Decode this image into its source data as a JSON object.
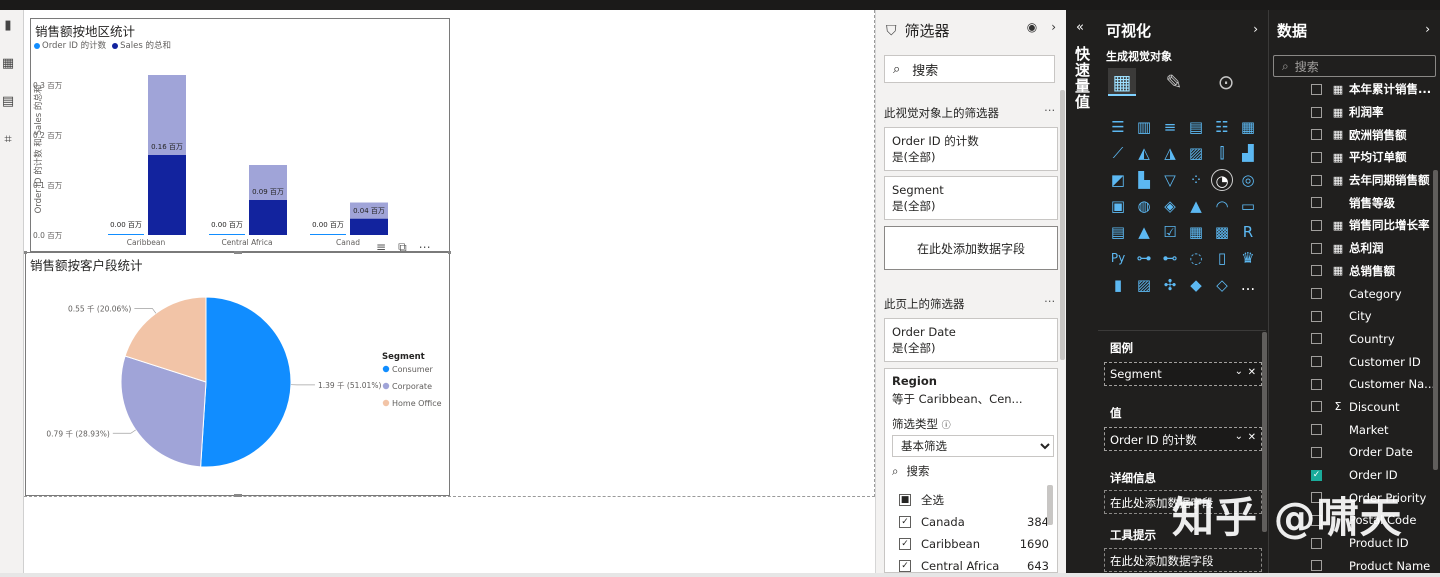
{
  "left_rail": {
    "icons": [
      "report-view-icon",
      "table-view-icon",
      "model-view-icon",
      "dax-query-icon"
    ]
  },
  "chart1": {
    "title": "销售额按地区统计",
    "legend": [
      "Order ID 的计数",
      "Sales 的总和"
    ],
    "ylabel": "Order ID 的计数 和 Sales 的总和"
  },
  "chart2": {
    "title": "销售额按客户段统计",
    "legend_title": "Segment"
  },
  "chart_data": [
    {
      "type": "bar",
      "title": "销售额按地区统计",
      "ylabel": "Order ID 的计数 和 Sales 的总和",
      "ylim": [
        0,
        0.3
      ],
      "y_ticks": [
        "0.0 百万",
        "0.1 百万",
        "0.2 百万",
        "0.3 百万"
      ],
      "categories": [
        "Caribbean",
        "Central Africa",
        "Canad"
      ],
      "series": [
        {
          "name": "Order ID 的计数",
          "values": [
            0.0,
            0.0,
            0.0
          ],
          "labels": [
            "0.00 百万",
            "0.00 百万",
            "0.00 百万"
          ],
          "color": "#118dff"
        },
        {
          "name": "Sales 的总和",
          "values": [
            0.32,
            0.14,
            0.065
          ],
          "color": "#12239e"
        }
      ],
      "overlay_labels": [
        "0.16 百万",
        "0.09 百万",
        "0.04 百万"
      ],
      "legend_position": "top-left"
    },
    {
      "type": "pie",
      "title": "销售额按客户段统计",
      "legend_title": "Segment",
      "legend_position": "right",
      "slices": [
        {
          "name": "Consumer",
          "value": 1390,
          "pct": 51.01,
          "label": "1.39 千 (51.01%)",
          "color": "#118dff"
        },
        {
          "name": "Corporate",
          "value": 790,
          "pct": 28.93,
          "label": "0.79 千 (28.93%)",
          "color": "#a0a4d8"
        },
        {
          "name": "Home Office",
          "value": 550,
          "pct": 20.06,
          "label": "0.55 千 (20.06%)",
          "color": "#f2c4a7"
        }
      ]
    }
  ],
  "filters": {
    "title": "筛选器",
    "search_placeholder": "搜索",
    "visual_section": "此视觉对象上的筛选器",
    "visual_cards": [
      {
        "name": "Order ID 的计数",
        "value": "是(全部)"
      },
      {
        "name": "Segment",
        "value": "是(全部)"
      }
    ],
    "add_field": "在此处添加数据字段",
    "page_section": "此页上的筛选器",
    "page_cards": [
      {
        "name": "Order Date",
        "value": "是(全部)"
      }
    ],
    "region": {
      "name": "Region",
      "summary": "等于 Caribbean、Cen...",
      "filter_type_label": "筛选类型",
      "filter_type_value": "基本筛选",
      "search": "搜索",
      "items": [
        {
          "label": "全选",
          "count": "",
          "state": "partial"
        },
        {
          "label": "Canada",
          "count": "384",
          "state": "checked"
        },
        {
          "label": "Caribbean",
          "count": "1690",
          "state": "checked"
        },
        {
          "label": "Central Africa",
          "count": "643",
          "state": "checked"
        }
      ]
    }
  },
  "bookmarks_rail": {
    "label": "快速量值"
  },
  "viz": {
    "title": "可视化",
    "build_label": "生成视觉对象",
    "legend_label": "图例",
    "legend_field": "Segment",
    "values_label": "值",
    "values_field": "Order ID 的计数",
    "details_label": "详细信息",
    "details_placeholder": "在此处添加数据字段",
    "tooltips_label": "工具提示",
    "tooltips_placeholder": "在此处添加数据字段",
    "more": "..."
  },
  "data_pane": {
    "title": "数据",
    "search_placeholder": "搜索",
    "fields": [
      {
        "label": "本年累计销售...",
        "icon": "calculator",
        "checked": false,
        "bold": true
      },
      {
        "label": "利润率",
        "icon": "calculator",
        "checked": false,
        "bold": true
      },
      {
        "label": "欧洲销售额",
        "icon": "calculator",
        "checked": false,
        "bold": true
      },
      {
        "label": "平均订单额",
        "icon": "calculator",
        "checked": false,
        "bold": true
      },
      {
        "label": "去年同期销售额",
        "icon": "calculator",
        "checked": false,
        "bold": true
      },
      {
        "label": "销售等级",
        "icon": "",
        "checked": false,
        "bold": true
      },
      {
        "label": "销售同比增长率",
        "icon": "calculator",
        "checked": false,
        "bold": true
      },
      {
        "label": "总利润",
        "icon": "calculator",
        "checked": false,
        "bold": true
      },
      {
        "label": "总销售额",
        "icon": "calculator",
        "checked": false,
        "bold": true
      },
      {
        "label": "Category",
        "icon": "",
        "checked": false,
        "bold": false
      },
      {
        "label": "City",
        "icon": "",
        "checked": false,
        "bold": false
      },
      {
        "label": "Country",
        "icon": "",
        "checked": false,
        "bold": false
      },
      {
        "label": "Customer ID",
        "icon": "",
        "checked": false,
        "bold": false
      },
      {
        "label": "Customer Na...",
        "icon": "",
        "checked": false,
        "bold": false
      },
      {
        "label": "Discount",
        "icon": "sigma",
        "checked": false,
        "bold": false
      },
      {
        "label": "Market",
        "icon": "",
        "checked": false,
        "bold": false
      },
      {
        "label": "Order Date",
        "icon": "",
        "checked": false,
        "bold": false
      },
      {
        "label": "Order ID",
        "icon": "",
        "checked": true,
        "bold": false
      },
      {
        "label": "Order Priority",
        "icon": "",
        "checked": false,
        "bold": false
      },
      {
        "label": "Postal Code",
        "icon": "",
        "checked": false,
        "bold": false
      },
      {
        "label": "Product ID",
        "icon": "",
        "checked": false,
        "bold": false
      },
      {
        "label": "Product Name",
        "icon": "",
        "checked": false,
        "bold": false
      }
    ]
  },
  "watermark": "知乎 @啸天"
}
